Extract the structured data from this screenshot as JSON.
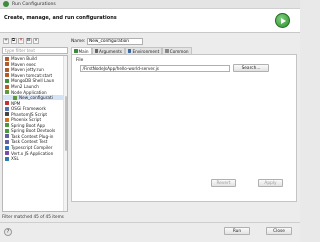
{
  "window": {
    "title": "Run Configurations",
    "header_title": "Create, manage, and run configurations"
  },
  "left": {
    "filter_placeholder": "type filter text",
    "tree": [
      {
        "label": "Maven Build",
        "icon_color": "#b35a2a"
      },
      {
        "label": "Maven exec",
        "icon_color": "#b35a2a"
      },
      {
        "label": "Maven jetty:run",
        "icon_color": "#b35a2a"
      },
      {
        "label": "Maven tomcat:start",
        "icon_color": "#b35a2a"
      },
      {
        "label": "MongoDB Shell Laun",
        "icon_color": "#3e8f3e"
      },
      {
        "label": "Mvn2 Launch",
        "icon_color": "#b35a2a"
      },
      {
        "label": "Node Application",
        "icon_color": "#5a9a3a"
      },
      {
        "label": "New_configurati",
        "icon_color": "#5a9a3a",
        "child": true,
        "selected": true
      },
      {
        "label": "NPM",
        "icon_color": "#c83030"
      },
      {
        "label": "OSGi Framework",
        "icon_color": "#5070b0"
      },
      {
        "label": "PhantomJS Script",
        "icon_color": "#444444"
      },
      {
        "label": "Phoenix Script",
        "icon_color": "#d07020"
      },
      {
        "label": "Spring Boot App",
        "icon_color": "#4a9a3a"
      },
      {
        "label": "Spring Boot Devtools",
        "icon_color": "#4a9a3a"
      },
      {
        "label": "Task Context Plug-in",
        "icon_color": "#6060a0"
      },
      {
        "label": "Task Context Test",
        "icon_color": "#6060a0"
      },
      {
        "label": "Typescript Compiler",
        "icon_color": "#3070c0"
      },
      {
        "label": "Vert.x JS Application",
        "icon_color": "#7a4ab0"
      },
      {
        "label": "XSL",
        "icon_color": "#2a7ab0"
      }
    ],
    "status": "Filter matched 45 of 45 items"
  },
  "right": {
    "name_label": "Name:",
    "name_value": "New_configuration",
    "tabs": [
      {
        "label": "Main",
        "icon_color": "#3a8a3a",
        "active": true
      },
      {
        "label": "Arguments",
        "icon_color": "#666666",
        "active": false
      },
      {
        "label": "Environment",
        "icon_color": "#3a6aa0",
        "active": false
      },
      {
        "label": "Common",
        "icon_color": "#888888",
        "active": false
      }
    ],
    "file_label": "File",
    "file_value": "/FirstNodeJsApp/hello-world-server.js",
    "search_label": "Search...",
    "revert_label": "Revert",
    "apply_label": "Apply"
  },
  "footer": {
    "help_label": "?",
    "run_label": "Run",
    "close_label": "Close"
  }
}
